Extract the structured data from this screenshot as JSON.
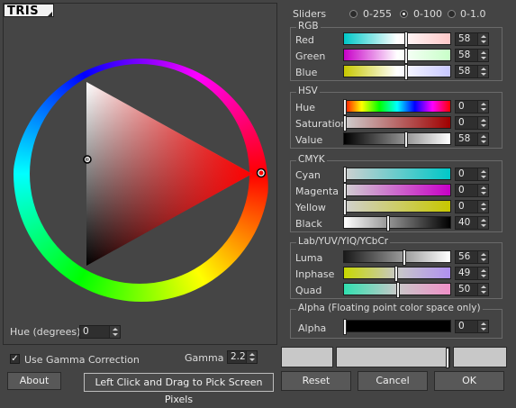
{
  "mode_tab": "TRIS",
  "sliders": {
    "label": "Sliders",
    "modes": [
      {
        "label": "0-255",
        "selected": false
      },
      {
        "label": "0-100",
        "selected": true
      },
      {
        "label": "0-1.0",
        "selected": false
      }
    ]
  },
  "groups": {
    "rgb": {
      "title": "RGB",
      "rows": [
        {
          "label": "Red",
          "value": "58",
          "level": 0.58
        },
        {
          "label": "Green",
          "value": "58",
          "level": 0.58
        },
        {
          "label": "Blue",
          "value": "58",
          "level": 0.58
        }
      ]
    },
    "hsv": {
      "title": "HSV",
      "rows": [
        {
          "label": "Hue",
          "value": "0",
          "level": 0
        },
        {
          "label": "Saturation",
          "value": "0",
          "level": 0
        },
        {
          "label": "Value",
          "value": "58",
          "level": 0.58
        }
      ]
    },
    "cmyk": {
      "title": "CMYK",
      "rows": [
        {
          "label": "Cyan",
          "value": "0",
          "level": 0
        },
        {
          "label": "Magenta",
          "value": "0",
          "level": 0
        },
        {
          "label": "Yellow",
          "value": "0",
          "level": 0
        },
        {
          "label": "Black",
          "value": "40",
          "level": 0.4
        }
      ]
    },
    "lab": {
      "title": "Lab/YUV/YIQ/YCbCr",
      "rows": [
        {
          "label": "Luma",
          "value": "56",
          "level": 0.56
        },
        {
          "label": "Inphase",
          "value": "49",
          "level": 0.49
        },
        {
          "label": "Quad",
          "value": "50",
          "level": 0.5
        }
      ]
    },
    "alpha": {
      "title": "Alpha (Floating point color space only)",
      "rows": [
        {
          "label": "Alpha",
          "value": "0",
          "level": 0
        }
      ]
    }
  },
  "hue_degrees": {
    "label": "Hue (degrees):",
    "value": "0"
  },
  "gamma": {
    "checkbox_label": "Use Gamma Correction",
    "checked": true,
    "label": "Gamma",
    "value": "2.2"
  },
  "buttons": {
    "about": "About",
    "pick": "Left Click and Drag to Pick Screen Pixels",
    "reset": "Reset",
    "cancel": "Cancel",
    "ok": "OK"
  },
  "colors": {
    "background": "#444444",
    "accent_red": "#ff0000",
    "swatch": "#c8c8c8"
  }
}
